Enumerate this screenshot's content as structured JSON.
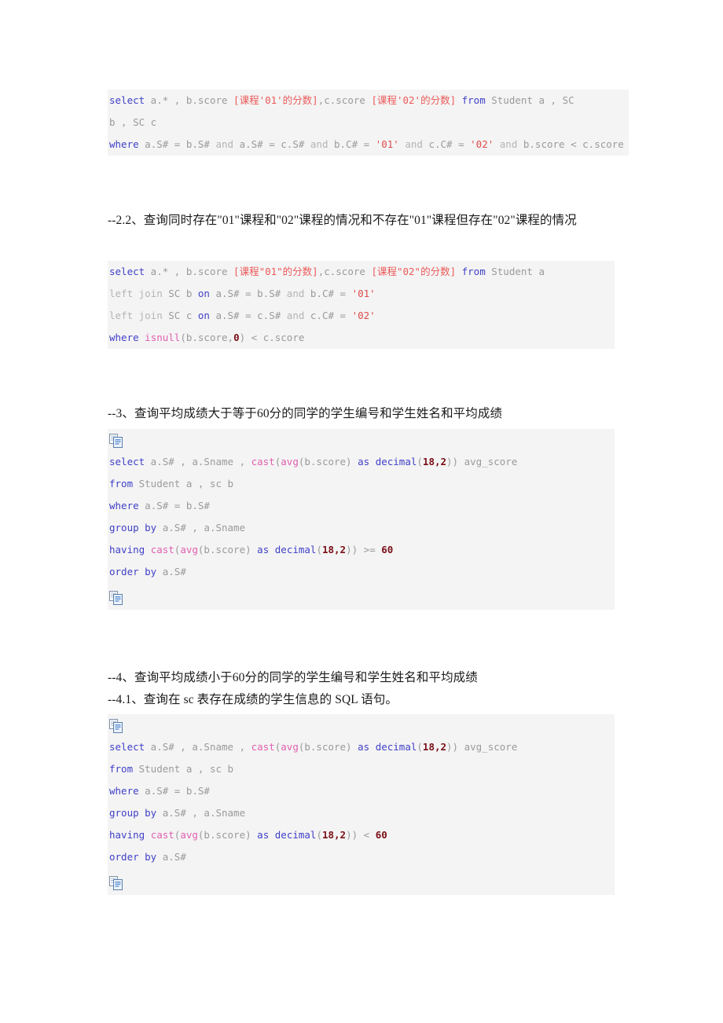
{
  "document": {
    "title": "SQL 练习题 — 学生成绩查询",
    "background": "#ffffff",
    "code_background": "#f4f4f4",
    "colors": {
      "keyword": "#4040c8",
      "dim_keyword": "#b4b4b4",
      "function": "#e060b0",
      "number": "#7a0f17",
      "string": "#e04b4b",
      "comment_alias": "#ec5a5a",
      "plain_code": "#9a9a9a",
      "heading_text": "#1a1a1a"
    }
  },
  "blocks": {
    "code1": {
      "lines": [
        [
          {
            "t": "select",
            "c": "kw"
          },
          {
            "t": " a.* , b.score ",
            "c": "plain"
          },
          {
            "t": "[课程'01'的分数]",
            "c": "cmt"
          },
          {
            "t": ",c.score ",
            "c": "plain"
          },
          {
            "t": "[课程'02'的分数]",
            "c": "cmt"
          },
          {
            "t": " ",
            "c": "plain"
          },
          {
            "t": "from",
            "c": "kw"
          },
          {
            "t": " Student a , SC",
            "c": "plain"
          }
        ],
        [
          {
            "t": "b , SC c",
            "c": "plain"
          }
        ],
        [
          {
            "t": "where",
            "c": "kw"
          },
          {
            "t": " a.S# = b.S# ",
            "c": "plain"
          },
          {
            "t": "and",
            "c": "dim"
          },
          {
            "t": " a.S# = c.S# ",
            "c": "plain"
          },
          {
            "t": "and",
            "c": "dim"
          },
          {
            "t": " b.C# = ",
            "c": "plain"
          },
          {
            "t": "'01'",
            "c": "str"
          },
          {
            "t": " ",
            "c": "plain"
          },
          {
            "t": "and",
            "c": "dim"
          },
          {
            "t": " c.C# = ",
            "c": "plain"
          },
          {
            "t": "'02'",
            "c": "str"
          },
          {
            "t": " ",
            "c": "plain"
          },
          {
            "t": "and",
            "c": "dim"
          },
          {
            "t": " b.score < c.score",
            "c": "plain"
          }
        ]
      ]
    },
    "heading_2_2": "--2.2、查询同时存在\"01\"课程和\"02\"课程的情况和不存在\"01\"课程但存在\"02\"课程的情况",
    "code2": {
      "lines": [
        [
          {
            "t": "select",
            "c": "kw"
          },
          {
            "t": " a.* , b.score ",
            "c": "plain"
          },
          {
            "t": "[课程\"01\"的分数]",
            "c": "cmt"
          },
          {
            "t": ",c.score ",
            "c": "plain"
          },
          {
            "t": "[课程\"02\"的分数]",
            "c": "cmt"
          },
          {
            "t": " ",
            "c": "plain"
          },
          {
            "t": "from",
            "c": "kw"
          },
          {
            "t": " Student a",
            "c": "plain"
          }
        ],
        [
          {
            "t": "left join",
            "c": "dim"
          },
          {
            "t": " SC b ",
            "c": "plain"
          },
          {
            "t": "on",
            "c": "kw"
          },
          {
            "t": " a.S# = b.S# ",
            "c": "plain"
          },
          {
            "t": "and",
            "c": "dim"
          },
          {
            "t": " b.C# = ",
            "c": "plain"
          },
          {
            "t": "'01'",
            "c": "str"
          }
        ],
        [
          {
            "t": "left join",
            "c": "dim"
          },
          {
            "t": " SC c ",
            "c": "plain"
          },
          {
            "t": "on",
            "c": "kw"
          },
          {
            "t": " a.S# = c.S# ",
            "c": "plain"
          },
          {
            "t": "and",
            "c": "dim"
          },
          {
            "t": " c.C# = ",
            "c": "plain"
          },
          {
            "t": "'02'",
            "c": "str"
          }
        ],
        [
          {
            "t": "where",
            "c": "kw"
          },
          {
            "t": " ",
            "c": "plain"
          },
          {
            "t": "isnull",
            "c": "fn"
          },
          {
            "t": "(b.score,",
            "c": "plain"
          },
          {
            "t": "0",
            "c": "num"
          },
          {
            "t": ") < c.score",
            "c": "plain"
          }
        ]
      ]
    },
    "heading_3": "--3、查询平均成绩大于等于60分的同学的学生编号和学生姓名和平均成绩",
    "code3": {
      "copy_icon_top": "copy-icon",
      "copy_icon_bottom": "copy-icon",
      "lines": [
        [
          {
            "t": "select",
            "c": "kw"
          },
          {
            "t": " a.S# , a.Sname , ",
            "c": "plain"
          },
          {
            "t": "cast",
            "c": "fn"
          },
          {
            "t": "(",
            "c": "plain"
          },
          {
            "t": "avg",
            "c": "fn"
          },
          {
            "t": "(b.score) ",
            "c": "plain"
          },
          {
            "t": "as",
            "c": "kw"
          },
          {
            "t": " ",
            "c": "plain"
          },
          {
            "t": "decimal",
            "c": "kw"
          },
          {
            "t": "(",
            "c": "plain"
          },
          {
            "t": "18,2",
            "c": "num"
          },
          {
            "t": ")) avg_score",
            "c": "plain"
          }
        ],
        [
          {
            "t": "from",
            "c": "kw"
          },
          {
            "t": " Student a , sc b",
            "c": "plain"
          }
        ],
        [
          {
            "t": "where",
            "c": "kw"
          },
          {
            "t": " a.S# = b.S#",
            "c": "plain"
          }
        ],
        [
          {
            "t": "group by",
            "c": "kw"
          },
          {
            "t": " a.S# , a.Sname",
            "c": "plain"
          }
        ],
        [
          {
            "t": "having",
            "c": "kw"
          },
          {
            "t": " ",
            "c": "plain"
          },
          {
            "t": "cast",
            "c": "fn"
          },
          {
            "t": "(",
            "c": "plain"
          },
          {
            "t": "avg",
            "c": "fn"
          },
          {
            "t": "(b.score) ",
            "c": "plain"
          },
          {
            "t": "as",
            "c": "kw"
          },
          {
            "t": " ",
            "c": "plain"
          },
          {
            "t": "decimal",
            "c": "kw"
          },
          {
            "t": "(",
            "c": "plain"
          },
          {
            "t": "18,2",
            "c": "num"
          },
          {
            "t": ")) >= ",
            "c": "plain"
          },
          {
            "t": "60",
            "c": "num"
          }
        ],
        [
          {
            "t": "order by",
            "c": "kw"
          },
          {
            "t": " a.S#",
            "c": "plain"
          }
        ]
      ]
    },
    "heading_4": "--4、查询平均成绩小于60分的同学的学生编号和学生姓名和平均成绩",
    "heading_4_1": "--4.1、查询在 sc 表存在成绩的学生信息的 SQL 语句。",
    "code4": {
      "copy_icon_top": "copy-icon",
      "copy_icon_bottom": "copy-icon",
      "lines": [
        [
          {
            "t": "select",
            "c": "kw"
          },
          {
            "t": " a.S# , a.Sname , ",
            "c": "plain"
          },
          {
            "t": "cast",
            "c": "fn"
          },
          {
            "t": "(",
            "c": "plain"
          },
          {
            "t": "avg",
            "c": "fn"
          },
          {
            "t": "(b.score) ",
            "c": "plain"
          },
          {
            "t": "as",
            "c": "kw"
          },
          {
            "t": " ",
            "c": "plain"
          },
          {
            "t": "decimal",
            "c": "kw"
          },
          {
            "t": "(",
            "c": "plain"
          },
          {
            "t": "18,2",
            "c": "num"
          },
          {
            "t": ")) avg_score",
            "c": "plain"
          }
        ],
        [
          {
            "t": "from",
            "c": "kw"
          },
          {
            "t": " Student a , sc b",
            "c": "plain"
          }
        ],
        [
          {
            "t": "where",
            "c": "kw"
          },
          {
            "t": " a.S# = b.S#",
            "c": "plain"
          }
        ],
        [
          {
            "t": "group by",
            "c": "kw"
          },
          {
            "t": " a.S# , a.Sname",
            "c": "plain"
          }
        ],
        [
          {
            "t": "having",
            "c": "kw"
          },
          {
            "t": " ",
            "c": "plain"
          },
          {
            "t": "cast",
            "c": "fn"
          },
          {
            "t": "(",
            "c": "plain"
          },
          {
            "t": "avg",
            "c": "fn"
          },
          {
            "t": "(b.score) ",
            "c": "plain"
          },
          {
            "t": "as",
            "c": "kw"
          },
          {
            "t": " ",
            "c": "plain"
          },
          {
            "t": "decimal",
            "c": "kw"
          },
          {
            "t": "(",
            "c": "plain"
          },
          {
            "t": "18,2",
            "c": "num"
          },
          {
            "t": ")) < ",
            "c": "plain"
          },
          {
            "t": "60",
            "c": "num"
          }
        ],
        [
          {
            "t": "order by",
            "c": "kw"
          },
          {
            "t": " a.S#",
            "c": "plain"
          }
        ]
      ]
    }
  }
}
